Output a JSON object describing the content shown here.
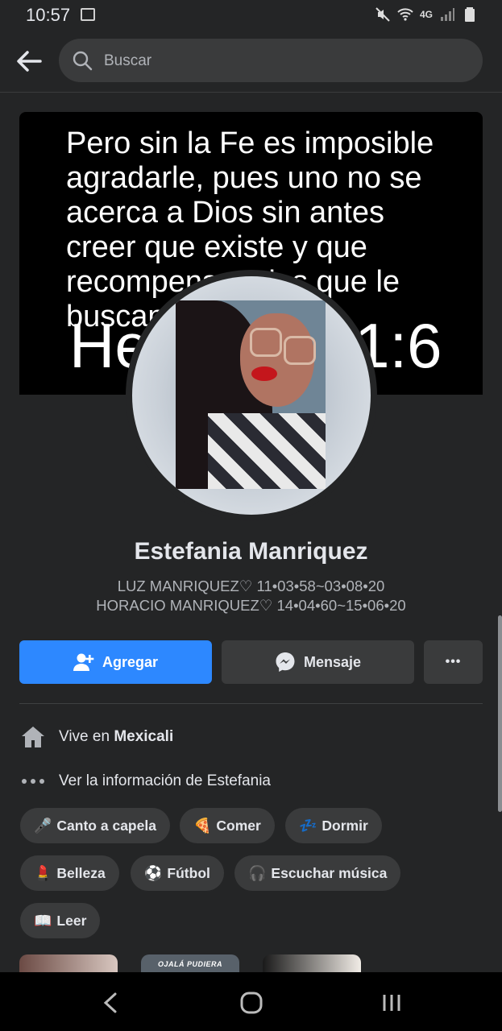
{
  "status_bar": {
    "time": "10:57",
    "network": "4G"
  },
  "search": {
    "placeholder": "Buscar"
  },
  "cover": {
    "quote": "Pero sin la Fe es imposible agradarle, pues uno no se acerca a Dios sin antes creer que existe y que recompensa a los que le buscan.",
    "reference": "Hebreos 11:6"
  },
  "profile": {
    "name": "Estefania Manriquez",
    "bio_line1": "LUZ MANRIQUEZ♡ 11•03•58~03•08•20",
    "bio_line2": "HORACIO MANRIQUEZ♡ 14•04•60~15•06•20"
  },
  "actions": {
    "add_label": "Agregar",
    "message_label": "Mensaje",
    "more_label": "•••"
  },
  "info": {
    "lives_prefix": "Vive en ",
    "lives_city": "Mexicali",
    "see_info": "Ver la información de Estefania"
  },
  "hobbies": [
    {
      "emoji": "🎤",
      "label": "Canto a capela"
    },
    {
      "emoji": "🍕",
      "label": "Comer"
    },
    {
      "emoji": "💤",
      "label": "Dormir"
    },
    {
      "emoji": "💄",
      "label": "Belleza"
    },
    {
      "emoji": "⚽",
      "label": "Fútbol"
    },
    {
      "emoji": "🎧",
      "label": "Escuchar música"
    },
    {
      "emoji": "📖",
      "label": "Leer"
    }
  ],
  "featured": {
    "item2_label": "OJALÁ PUDIERA"
  },
  "colors": {
    "accent": "#2d88ff",
    "background": "#242526",
    "surface": "#3a3b3c"
  }
}
